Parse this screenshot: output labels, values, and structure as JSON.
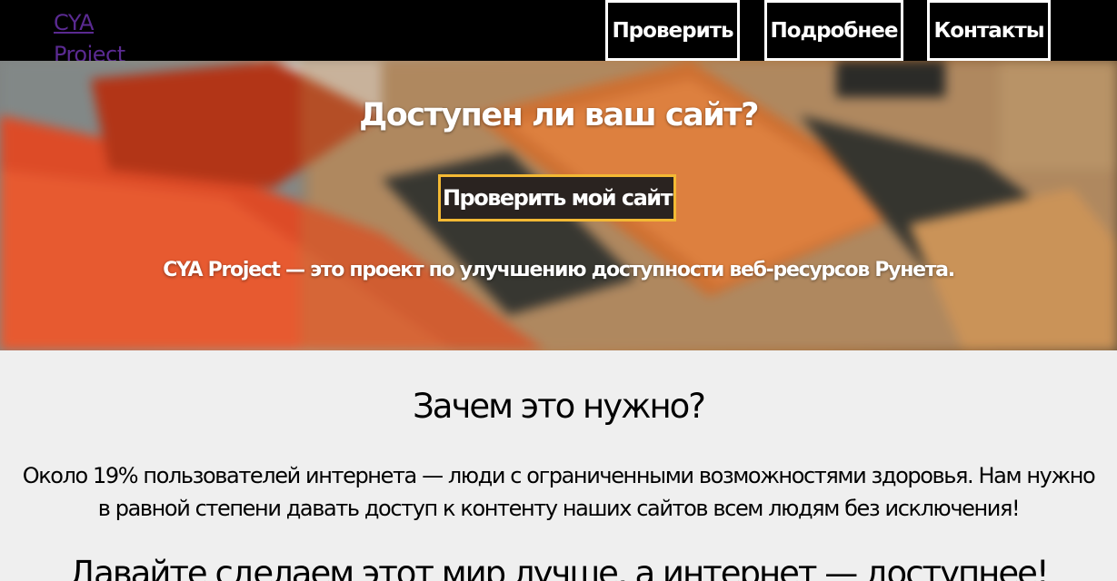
{
  "header": {
    "logo": "CYA Project",
    "nav": [
      {
        "label": "Проверить"
      },
      {
        "label": "Подробнее"
      },
      {
        "label": "Контакты"
      }
    ]
  },
  "hero": {
    "title": "Доступен ли ваш сайт?",
    "cta_label": "Проверить мой сайт",
    "description": "CYA Project — это проект по улучшению доступности веб-ресурсов Рунета."
  },
  "about": {
    "title": "Зачем это нужно?",
    "text": "Около 19% пользователей интернета — люди с ограниченными возможностями здоровья. Нам нужно в равной степени давать доступ к контенту наших сайтов всем людям без исключения!",
    "call_title": "Давайте сделаем этот мир лучше, а интернет — доступнее!"
  },
  "colors": {
    "nav_bg": "#000000",
    "logo_link": "#5a2a91",
    "cta_border": "#f3b934",
    "content_bg": "#efefef"
  }
}
